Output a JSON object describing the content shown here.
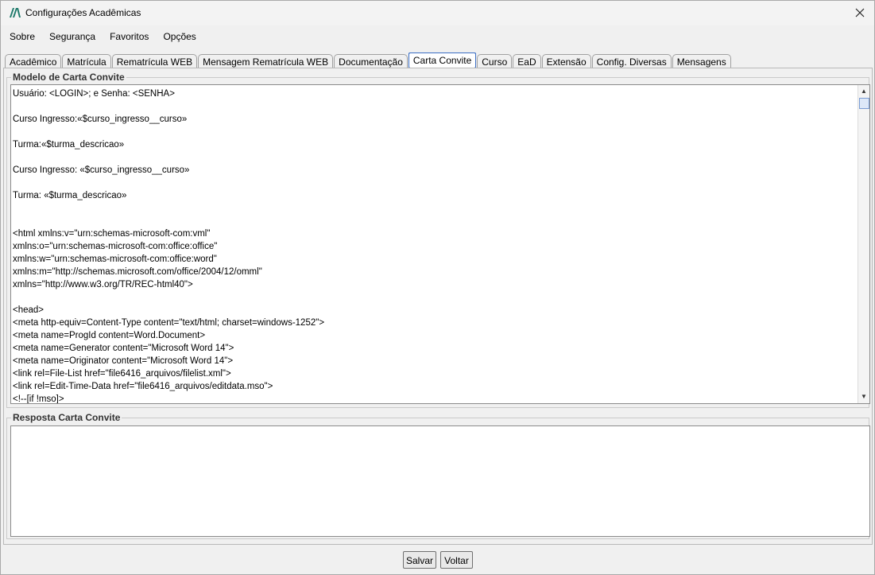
{
  "window": {
    "title": "Configurações Acadêmicas",
    "app_icon": "logo-icon",
    "close_icon": "close-icon"
  },
  "menu": [
    {
      "label": "Sobre"
    },
    {
      "label": "Segurança"
    },
    {
      "label": "Favoritos"
    },
    {
      "label": "Opções"
    }
  ],
  "tabs": [
    {
      "label": "Acadêmico"
    },
    {
      "label": "Matrícula"
    },
    {
      "label": "Rematrícula WEB"
    },
    {
      "label": "Mensagem Rematrícula WEB"
    },
    {
      "label": "Documentação"
    },
    {
      "label": "Carta Convite",
      "active": true
    },
    {
      "label": "Curso"
    },
    {
      "label": "EaD"
    },
    {
      "label": "Extensão"
    },
    {
      "label": "Config. Diversas"
    },
    {
      "label": "Mensagens"
    }
  ],
  "modelo": {
    "label": "Modelo de Carta Convite",
    "lines": [
      "Usuário: <LOGIN>; e Senha: <SENHA>",
      "",
      "Curso Ingresso:«$curso_ingresso__curso»",
      "",
      "Turma:«$turma_descricao»",
      "",
      "Curso Ingresso: «$curso_ingresso__curso»",
      "",
      "Turma: «$turma_descricao»",
      "",
      "",
      "<html xmlns:v=\"urn:schemas-microsoft-com:vml\"",
      "xmlns:o=\"urn:schemas-microsoft-com:office:office\"",
      "xmlns:w=\"urn:schemas-microsoft-com:office:word\"",
      "xmlns:m=\"http://schemas.microsoft.com/office/2004/12/omml\"",
      "xmlns=\"http://www.w3.org/TR/REC-html40\">",
      "",
      "<head>",
      "<meta http-equiv=Content-Type content=\"text/html; charset=windows-1252\">",
      "<meta name=ProgId content=Word.Document>",
      "<meta name=Generator content=\"Microsoft Word 14\">",
      "<meta name=Originator content=\"Microsoft Word 14\">",
      "<link rel=File-List href=\"file6416_arquivos/filelist.xml\">",
      "<link rel=Edit-Time-Data href=\"file6416_arquivos/editdata.mso\">",
      "<!--[if !mso]>"
    ]
  },
  "resposta": {
    "label": "Resposta Carta Convite",
    "value": ""
  },
  "buttons": {
    "save": "Salvar",
    "back": "Voltar"
  }
}
